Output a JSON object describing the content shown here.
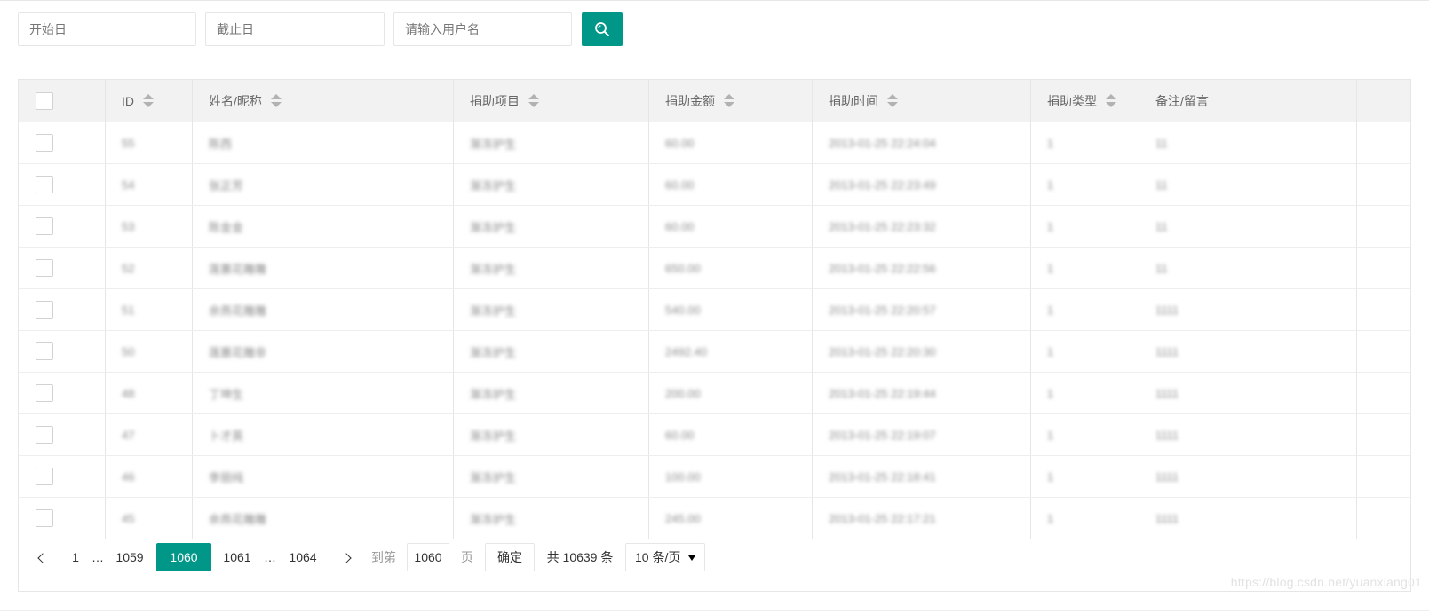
{
  "search": {
    "start_placeholder": "开始日",
    "end_placeholder": "截止日",
    "username_placeholder": "请输入用户名",
    "button_icon": "search-icon",
    "accent_color": "#009688"
  },
  "table": {
    "columns": [
      {
        "label": "",
        "sortable": false
      },
      {
        "label": "ID",
        "sortable": true
      },
      {
        "label": "姓名/昵称",
        "sortable": true
      },
      {
        "label": "捐助项目",
        "sortable": true
      },
      {
        "label": "捐助金额",
        "sortable": true
      },
      {
        "label": "捐助时间",
        "sortable": true
      },
      {
        "label": "捐助类型",
        "sortable": true
      },
      {
        "label": "备注/留言",
        "sortable": false
      }
    ],
    "rows": [
      {
        "id": "55",
        "name": "陈西",
        "project": "渐冻护生",
        "amount": "60.00",
        "time": "2013-01-25 22:24:04",
        "type": "1",
        "note": "11"
      },
      {
        "id": "54",
        "name": "张正芳",
        "project": "渐冻护生",
        "amount": "60.00",
        "time": "2013-01-25 22:23:49",
        "type": "1",
        "note": "11"
      },
      {
        "id": "53",
        "name": "陈金金",
        "project": "渐冻护生",
        "amount": "60.00",
        "time": "2013-01-25 22:23:32",
        "type": "1",
        "note": "11"
      },
      {
        "id": "52",
        "name": "莲蕙花雕雕",
        "project": "渐冻护生",
        "amount": "650.00",
        "time": "2013-01-25 22:22:56",
        "type": "1",
        "note": "11"
      },
      {
        "id": "51",
        "name": "余燕花雕雕",
        "project": "渐冻护生",
        "amount": "540.00",
        "time": "2013-01-25 22:20:57",
        "type": "1",
        "note": "1111"
      },
      {
        "id": "50",
        "name": "莲蕙花雕非",
        "project": "渐冻护生",
        "amount": "2492.40",
        "time": "2013-01-25 22:20:30",
        "type": "1",
        "note": "1111"
      },
      {
        "id": "48",
        "name": "丁坤生",
        "project": "渐冻护生",
        "amount": "200.00",
        "time": "2013-01-25 22:19:44",
        "type": "1",
        "note": "1111"
      },
      {
        "id": "47",
        "name": "卜才英",
        "project": "渐冻护生",
        "amount": "60.00",
        "time": "2013-01-25 22:19:07",
        "type": "1",
        "note": "1111"
      },
      {
        "id": "46",
        "name": "李丽纯",
        "project": "渐冻护生",
        "amount": "100.00",
        "time": "2013-01-25 22:18:41",
        "type": "1",
        "note": "1111"
      },
      {
        "id": "45",
        "name": "余燕花雕雕",
        "project": "渐冻护生",
        "amount": "245.00",
        "time": "2013-01-25 22:17:21",
        "type": "1",
        "note": "1111"
      }
    ]
  },
  "pagination": {
    "prev_icon": "chevron-left-icon",
    "next_icon": "chevron-right-icon",
    "first": "1",
    "ellipsis": "…",
    "pages": [
      "1059",
      "1060",
      "1061"
    ],
    "current": "1060",
    "last": "1064",
    "goto_label": "到第",
    "goto_value": "1060",
    "page_unit": "页",
    "confirm": "确定",
    "total_text": "共 10639 条",
    "limit": "10 条/页"
  },
  "watermark": "https://blog.csdn.net/yuanxiang01"
}
